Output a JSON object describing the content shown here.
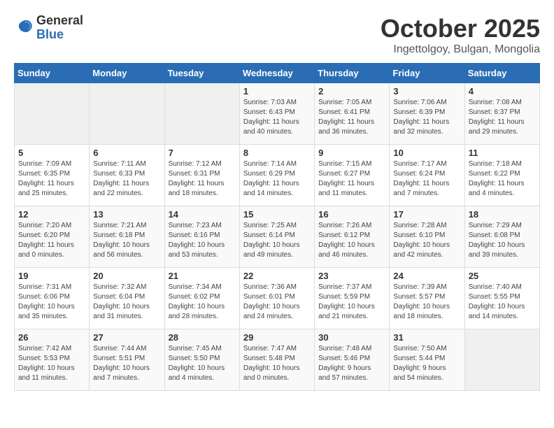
{
  "logo": {
    "general": "General",
    "blue": "Blue"
  },
  "title": "October 2025",
  "location": "Ingettolgoy, Bulgan, Mongolia",
  "headers": [
    "Sunday",
    "Monday",
    "Tuesday",
    "Wednesday",
    "Thursday",
    "Friday",
    "Saturday"
  ],
  "weeks": [
    [
      {
        "day": "",
        "info": ""
      },
      {
        "day": "",
        "info": ""
      },
      {
        "day": "",
        "info": ""
      },
      {
        "day": "1",
        "info": "Sunrise: 7:03 AM\nSunset: 6:43 PM\nDaylight: 11 hours\nand 40 minutes."
      },
      {
        "day": "2",
        "info": "Sunrise: 7:05 AM\nSunset: 6:41 PM\nDaylight: 11 hours\nand 36 minutes."
      },
      {
        "day": "3",
        "info": "Sunrise: 7:06 AM\nSunset: 6:39 PM\nDaylight: 11 hours\nand 32 minutes."
      },
      {
        "day": "4",
        "info": "Sunrise: 7:08 AM\nSunset: 6:37 PM\nDaylight: 11 hours\nand 29 minutes."
      }
    ],
    [
      {
        "day": "5",
        "info": "Sunrise: 7:09 AM\nSunset: 6:35 PM\nDaylight: 11 hours\nand 25 minutes."
      },
      {
        "day": "6",
        "info": "Sunrise: 7:11 AM\nSunset: 6:33 PM\nDaylight: 11 hours\nand 22 minutes."
      },
      {
        "day": "7",
        "info": "Sunrise: 7:12 AM\nSunset: 6:31 PM\nDaylight: 11 hours\nand 18 minutes."
      },
      {
        "day": "8",
        "info": "Sunrise: 7:14 AM\nSunset: 6:29 PM\nDaylight: 11 hours\nand 14 minutes."
      },
      {
        "day": "9",
        "info": "Sunrise: 7:15 AM\nSunset: 6:27 PM\nDaylight: 11 hours\nand 11 minutes."
      },
      {
        "day": "10",
        "info": "Sunrise: 7:17 AM\nSunset: 6:24 PM\nDaylight: 11 hours\nand 7 minutes."
      },
      {
        "day": "11",
        "info": "Sunrise: 7:18 AM\nSunset: 6:22 PM\nDaylight: 11 hours\nand 4 minutes."
      }
    ],
    [
      {
        "day": "12",
        "info": "Sunrise: 7:20 AM\nSunset: 6:20 PM\nDaylight: 11 hours\nand 0 minutes."
      },
      {
        "day": "13",
        "info": "Sunrise: 7:21 AM\nSunset: 6:18 PM\nDaylight: 10 hours\nand 56 minutes."
      },
      {
        "day": "14",
        "info": "Sunrise: 7:23 AM\nSunset: 6:16 PM\nDaylight: 10 hours\nand 53 minutes."
      },
      {
        "day": "15",
        "info": "Sunrise: 7:25 AM\nSunset: 6:14 PM\nDaylight: 10 hours\nand 49 minutes."
      },
      {
        "day": "16",
        "info": "Sunrise: 7:26 AM\nSunset: 6:12 PM\nDaylight: 10 hours\nand 46 minutes."
      },
      {
        "day": "17",
        "info": "Sunrise: 7:28 AM\nSunset: 6:10 PM\nDaylight: 10 hours\nand 42 minutes."
      },
      {
        "day": "18",
        "info": "Sunrise: 7:29 AM\nSunset: 6:08 PM\nDaylight: 10 hours\nand 39 minutes."
      }
    ],
    [
      {
        "day": "19",
        "info": "Sunrise: 7:31 AM\nSunset: 6:06 PM\nDaylight: 10 hours\nand 35 minutes."
      },
      {
        "day": "20",
        "info": "Sunrise: 7:32 AM\nSunset: 6:04 PM\nDaylight: 10 hours\nand 31 minutes."
      },
      {
        "day": "21",
        "info": "Sunrise: 7:34 AM\nSunset: 6:02 PM\nDaylight: 10 hours\nand 28 minutes."
      },
      {
        "day": "22",
        "info": "Sunrise: 7:36 AM\nSunset: 6:01 PM\nDaylight: 10 hours\nand 24 minutes."
      },
      {
        "day": "23",
        "info": "Sunrise: 7:37 AM\nSunset: 5:59 PM\nDaylight: 10 hours\nand 21 minutes."
      },
      {
        "day": "24",
        "info": "Sunrise: 7:39 AM\nSunset: 5:57 PM\nDaylight: 10 hours\nand 18 minutes."
      },
      {
        "day": "25",
        "info": "Sunrise: 7:40 AM\nSunset: 5:55 PM\nDaylight: 10 hours\nand 14 minutes."
      }
    ],
    [
      {
        "day": "26",
        "info": "Sunrise: 7:42 AM\nSunset: 5:53 PM\nDaylight: 10 hours\nand 11 minutes."
      },
      {
        "day": "27",
        "info": "Sunrise: 7:44 AM\nSunset: 5:51 PM\nDaylight: 10 hours\nand 7 minutes."
      },
      {
        "day": "28",
        "info": "Sunrise: 7:45 AM\nSunset: 5:50 PM\nDaylight: 10 hours\nand 4 minutes."
      },
      {
        "day": "29",
        "info": "Sunrise: 7:47 AM\nSunset: 5:48 PM\nDaylight: 10 hours\nand 0 minutes."
      },
      {
        "day": "30",
        "info": "Sunrise: 7:48 AM\nSunset: 5:46 PM\nDaylight: 9 hours\nand 57 minutes."
      },
      {
        "day": "31",
        "info": "Sunrise: 7:50 AM\nSunset: 5:44 PM\nDaylight: 9 hours\nand 54 minutes."
      },
      {
        "day": "",
        "info": ""
      }
    ]
  ]
}
